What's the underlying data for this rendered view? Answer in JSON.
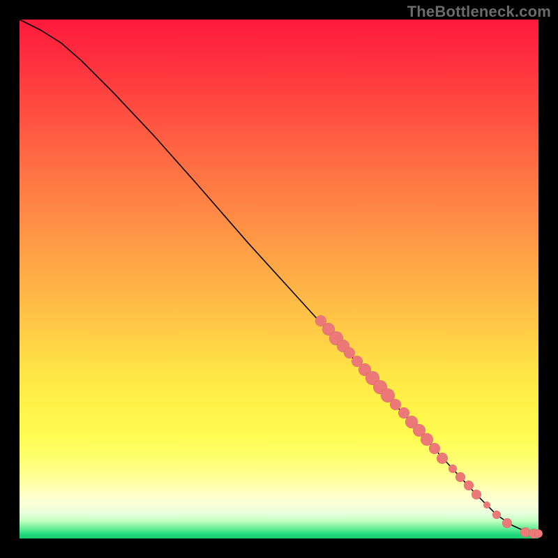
{
  "watermark": "TheBottleneck.com",
  "colors": {
    "point_fill": "#ed7878",
    "curve_stroke": "#000000",
    "background": "#000000"
  },
  "chart_data": {
    "type": "line",
    "title": "",
    "xlabel": "",
    "ylabel": "",
    "xlim": [
      0,
      100
    ],
    "ylim": [
      0,
      100
    ],
    "grid": false,
    "curve_note": "smooth decreasing curve with slight initial convex shoulder then near-linear descent, flattening at bottom right",
    "curve": {
      "x": [
        0,
        4,
        8,
        12,
        18,
        26,
        34,
        44,
        54,
        64,
        74,
        82,
        88,
        92,
        95,
        97,
        98.5,
        99.5,
        100
      ],
      "y": [
        100,
        98,
        95.5,
        92,
        86,
        77.5,
        68.5,
        57,
        46,
        35,
        24,
        15,
        8.5,
        4.5,
        2.5,
        1.6,
        1.1,
        0.9,
        0.9
      ]
    },
    "points_note": "cluster of overlapping salmon circles along lower-right portion of curve, values are (x %, y %, radius px) estimated from pixels",
    "points": [
      {
        "x": 58.0,
        "y": 42.0,
        "r": 8
      },
      {
        "x": 59.5,
        "y": 40.3,
        "r": 9
      },
      {
        "x": 61.0,
        "y": 38.6,
        "r": 10
      },
      {
        "x": 62.3,
        "y": 37.1,
        "r": 9
      },
      {
        "x": 63.6,
        "y": 35.7,
        "r": 8
      },
      {
        "x": 65.0,
        "y": 34.2,
        "r": 8
      },
      {
        "x": 66.5,
        "y": 32.5,
        "r": 9
      },
      {
        "x": 68.0,
        "y": 30.9,
        "r": 10
      },
      {
        "x": 69.5,
        "y": 29.2,
        "r": 10
      },
      {
        "x": 71.0,
        "y": 27.5,
        "r": 10
      },
      {
        "x": 72.5,
        "y": 25.8,
        "r": 8
      },
      {
        "x": 74.0,
        "y": 24.2,
        "r": 8
      },
      {
        "x": 75.5,
        "y": 22.5,
        "r": 9
      },
      {
        "x": 77.0,
        "y": 20.8,
        "r": 9
      },
      {
        "x": 78.5,
        "y": 19.1,
        "r": 9
      },
      {
        "x": 80.0,
        "y": 17.3,
        "r": 8
      },
      {
        "x": 81.5,
        "y": 15.5,
        "r": 8
      },
      {
        "x": 83.5,
        "y": 13.5,
        "r": 6
      },
      {
        "x": 85.0,
        "y": 11.8,
        "r": 7
      },
      {
        "x": 86.5,
        "y": 10.2,
        "r": 7
      },
      {
        "x": 88.0,
        "y": 8.5,
        "r": 7
      },
      {
        "x": 90.0,
        "y": 6.5,
        "r": 5
      },
      {
        "x": 92.0,
        "y": 4.6,
        "r": 6
      },
      {
        "x": 94.0,
        "y": 3.0,
        "r": 7
      },
      {
        "x": 97.5,
        "y": 1.2,
        "r": 7
      },
      {
        "x": 99.0,
        "y": 1.0,
        "r": 7
      },
      {
        "x": 100.0,
        "y": 1.0,
        "r": 6
      }
    ]
  }
}
